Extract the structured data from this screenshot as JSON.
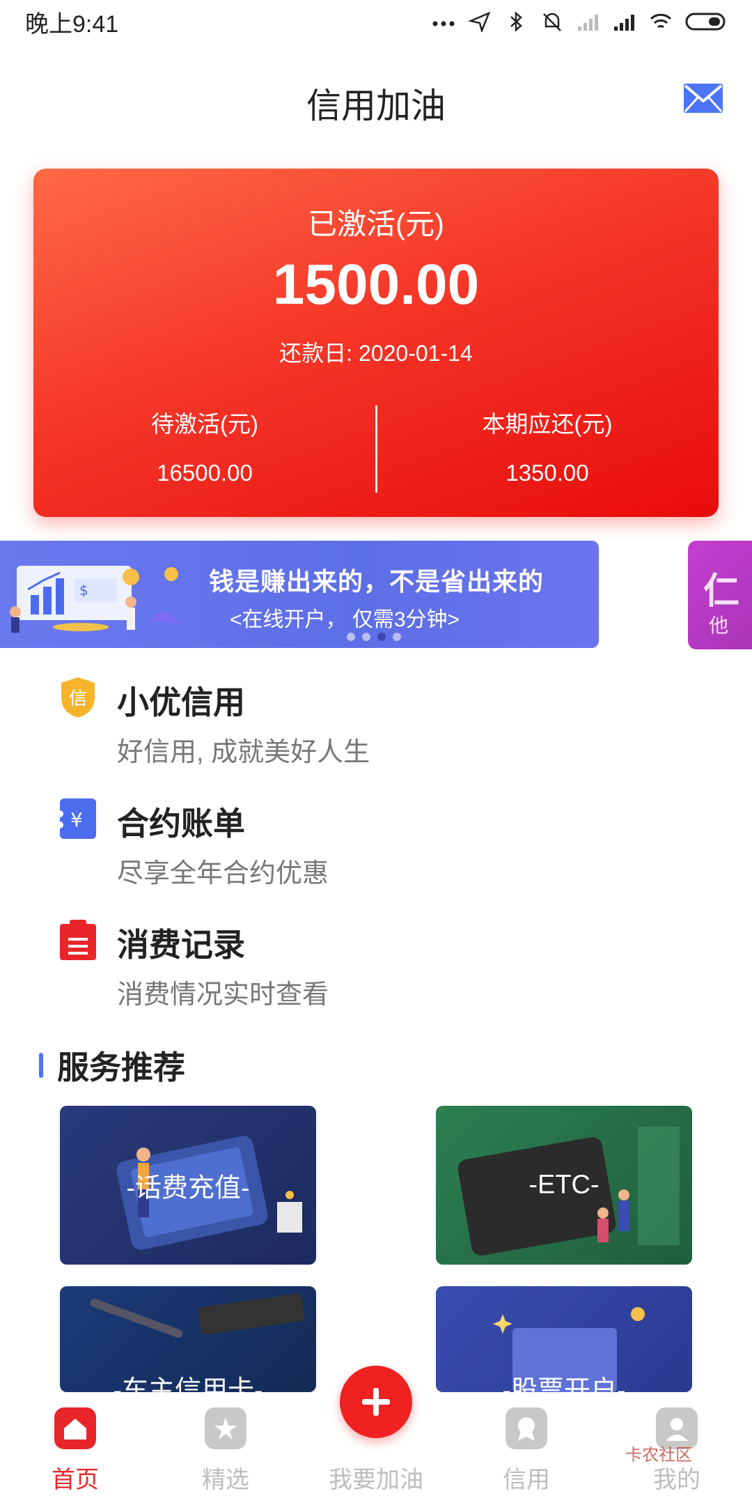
{
  "status_bar": {
    "time": "晚上9:41"
  },
  "header": {
    "title": "信用加油"
  },
  "card": {
    "label": "已激活(元)",
    "amount": "1500.00",
    "repay_date": "还款日: 2020-01-14",
    "left_label": "待激活(元)",
    "left_value": "16500.00",
    "right_label": "本期应还(元)",
    "right_value": "1350.00"
  },
  "banner": {
    "line1": "钱是赚出来的，不是省出来的",
    "line2": "<在线开户， 仅需3分钟>",
    "peek_line1": "仁",
    "peek_line2": "他"
  },
  "features": [
    {
      "icon": "shield-icon",
      "title": "小优信用",
      "subtitle": "好信用, 成就美好人生"
    },
    {
      "icon": "yuan-icon",
      "title": "合约账单",
      "subtitle": "尽享全年合约优惠"
    },
    {
      "icon": "record-icon",
      "title": "消费记录",
      "subtitle": "消费情况实时查看"
    }
  ],
  "section": {
    "title": "服务推荐"
  },
  "services": [
    {
      "label": "-话费充值-"
    },
    {
      "label": "-ETC-"
    },
    {
      "label": "-车主信用卡-"
    },
    {
      "label": "-股票开户-"
    }
  ],
  "bottom_nav": {
    "items": [
      {
        "label": "首页",
        "active": true
      },
      {
        "label": "精选",
        "active": false
      },
      {
        "label": "我要加油",
        "active": false
      },
      {
        "label": "信用",
        "active": false
      },
      {
        "label": "我的",
        "active": false
      }
    ]
  },
  "watermark": "卡农社区",
  "colors": {
    "accent": "#e8262a",
    "card_red": "#f43628",
    "banner_blue": "#5d6fe6",
    "section_bar": "#4c74f5"
  }
}
